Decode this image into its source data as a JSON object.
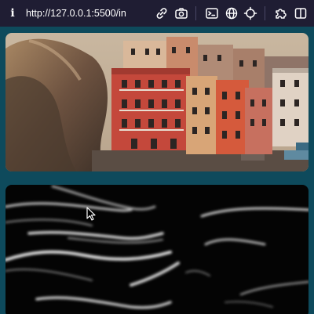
{
  "browser": {
    "url": "http://127.0.0.1:5500/in",
    "info_icon_glyph": "i",
    "toolbar_icons": [
      "link-icon",
      "camera-icon",
      "terminal-icon",
      "globe-icon",
      "crosshair-icon",
      "extensions-icon",
      "sidebar-icon"
    ],
    "background_color": "#1f1d33",
    "page_background": "#0e4a5c"
  },
  "content": {
    "cards": [
      "coastal-village-photo",
      "abstract-light-waves-animation"
    ]
  }
}
